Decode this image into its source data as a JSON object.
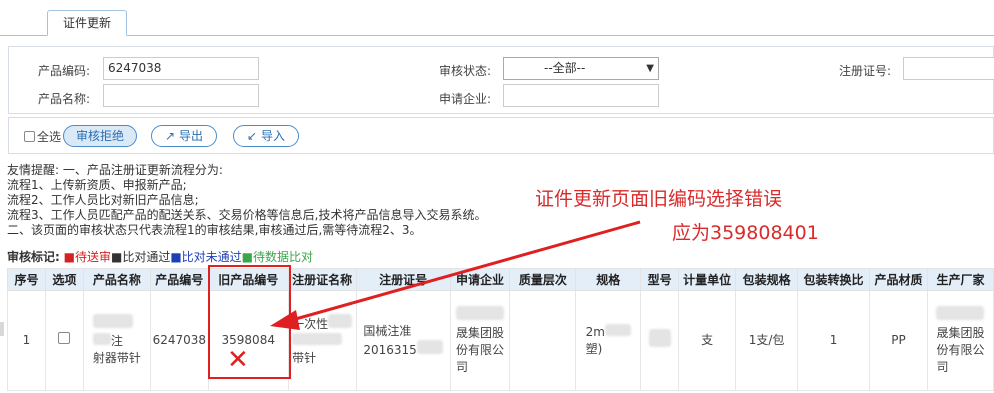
{
  "tab": {
    "label": "证件更新"
  },
  "filter": {
    "product_code_label": "产品编码:",
    "product_code_value": "6247038",
    "product_name_label": "产品名称:",
    "product_name_value": "",
    "audit_status_label": "审核状态:",
    "audit_status_value": "--全部--",
    "applicant_label": "申请企业:",
    "applicant_value": "",
    "reg_no_label": "注册证号:",
    "reg_no_value": ""
  },
  "toolbar": {
    "select_all_label": "全选",
    "reject_label": "审核拒绝",
    "export_label": "导出",
    "import_label": "导入"
  },
  "tips": {
    "line1": "友情提醒: 一、产品注册证更新流程分为:",
    "line2": "流程1、上传新资质、申报新产品;",
    "line3": "流程2、工作人员比对新旧产品信息;",
    "line4": "流程3、工作人员匹配产品的配送关系、交易价格等信息后,技术将产品信息导入交易系统。",
    "line5": "二、该页面的审核状态只代表流程1的审核结果,审核通过后,需等待流程2、3。"
  },
  "legend": {
    "title": "审核标记:",
    "pending": "■待送审",
    "passed": "■比对通过",
    "not_passed": "■比对未通过",
    "waiting": "■待数据比对"
  },
  "annotation": {
    "line1": "证件更新页面旧编码选择错误",
    "line2": "应为359808401",
    "mark": "✕"
  },
  "table": {
    "headers": [
      "序号",
      "选项",
      "产品名称",
      "产品编号",
      "旧产品编号",
      "注册证名称",
      "注册证号",
      "申请企业",
      "质量层次",
      "规格",
      "型号",
      "计量单位",
      "包装规格",
      "包装转换比",
      "产品材质",
      "生产厂家"
    ],
    "row": {
      "seq": "1",
      "name_line1": "注",
      "name_line2": "射器带针",
      "code": "6247038",
      "old_code": "3598084",
      "reg_name_line1": "一次性",
      "reg_name_line2": "带针",
      "reg_no_line1": "国械注准",
      "reg_no_line2": "2016315",
      "applicant_line2": "晟集团股",
      "applicant_line3": "份有限公",
      "applicant_line4": "司",
      "spec_line1": "2m",
      "spec_line2": "塑)",
      "unit": "支",
      "pack": "1支/包",
      "ratio": "1",
      "material": "PP",
      "maker_line2": "晟集团股",
      "maker_line3": "份有限公",
      "maker_line4": "司"
    }
  },
  "colors": {
    "accent": "#2a6fb0",
    "annotation": "#d92b2b",
    "header_bg": "#e3eef9"
  }
}
